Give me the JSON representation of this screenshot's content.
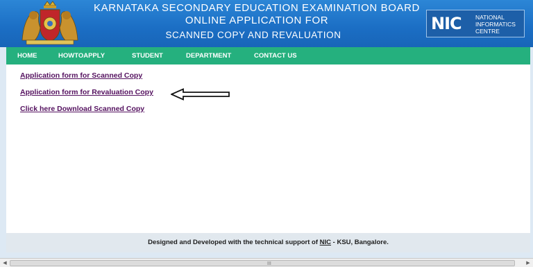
{
  "header": {
    "title_line1": "KARNATAKA SECONDARY EDUCATION EXAMINATION BOARD",
    "title_line2": "ONLINE APPLICATION FOR",
    "title_line3": "SCANNED COPY AND REVALUATION",
    "emblem_icon": "karnataka-emblem-icon",
    "nic_logo": {
      "mark": "NIC",
      "line1": "NATIONAL",
      "line2": "INFORMATICS",
      "line3": "CENTRE"
    }
  },
  "nav": {
    "items": [
      {
        "label": "HOME"
      },
      {
        "label": "HOWTOAPPLY"
      },
      {
        "label": "STUDENT"
      },
      {
        "label": "DEPARTMENT"
      },
      {
        "label": "CONTACT US"
      }
    ]
  },
  "main": {
    "links": [
      {
        "label": "Application form for Scanned Copy"
      },
      {
        "label": "Application form for Revaluation Copy"
      },
      {
        "label": "Click here Download Scanned Copy"
      }
    ],
    "annotation_icon": "left-arrow-icon"
  },
  "footer": {
    "text_before": "Designed and Developed with the technical support of ",
    "link_label": "NIC",
    "text_after": " - KSU, Bangalore."
  },
  "scrollbar": {
    "grip_label": "III"
  },
  "colors": {
    "header_blue": "#1b6ec4",
    "nav_green": "#25b07e",
    "link_purple": "#54115f",
    "page_background": "#dde9f4"
  }
}
